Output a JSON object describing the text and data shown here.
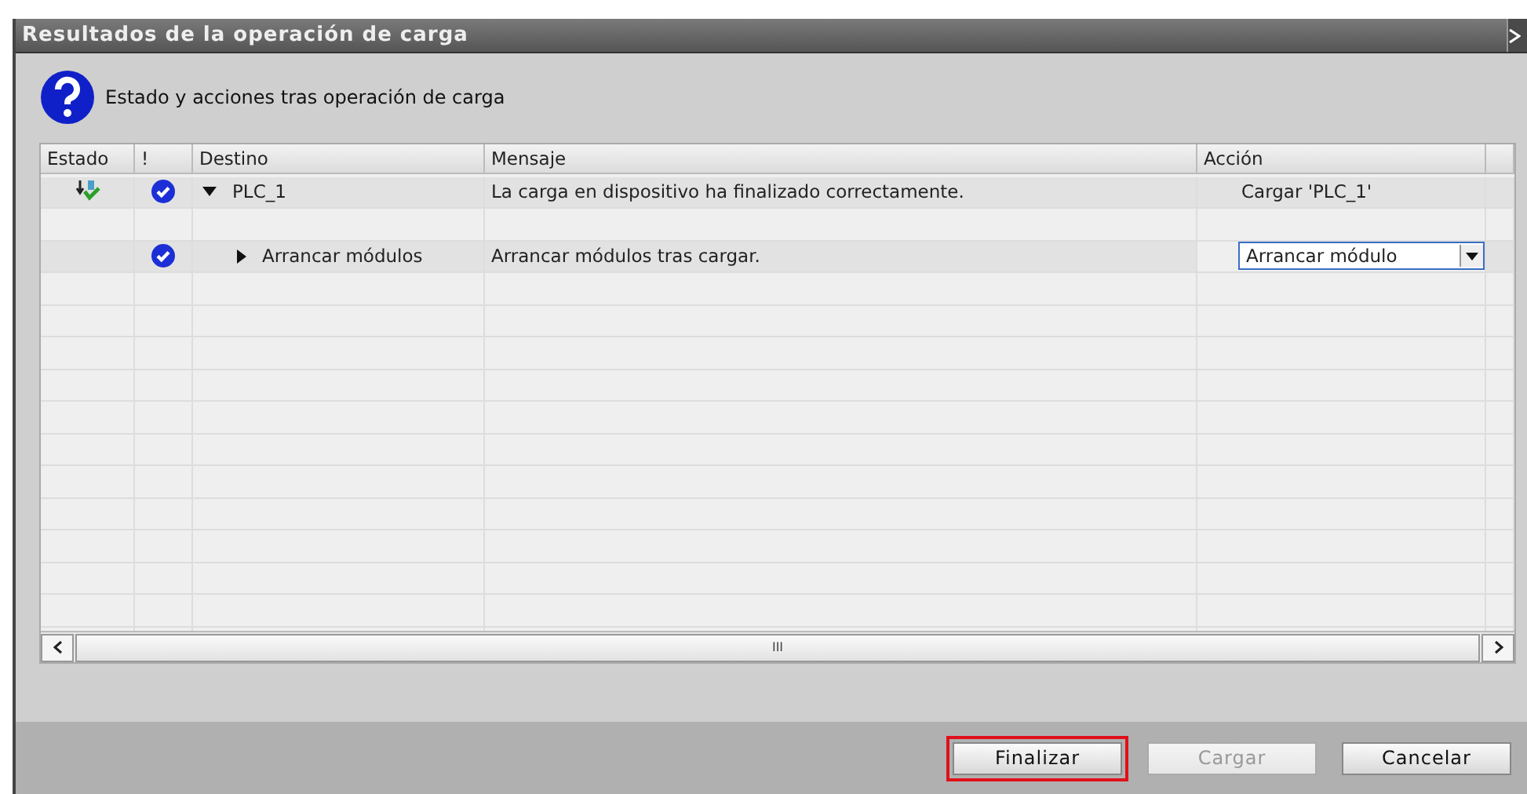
{
  "window": {
    "title": "Resultados de la operación de carga"
  },
  "header": {
    "text": "Estado y acciones tras operación de carga"
  },
  "table": {
    "columns": [
      "Estado",
      "!",
      "Destino",
      "Mensaje",
      "Acción"
    ],
    "rows": [
      {
        "kind": "item",
        "downloaded": true,
        "checked": true,
        "destino": "PLC_1",
        "expanded": true,
        "mensaje": "La carga en dispositivo ha finalizado correctamente.",
        "accion": "Cargar 'PLC_1'",
        "children": [
          {
            "kind": "blank"
          },
          {
            "kind": "dropdown",
            "checked": true,
            "destino": "Arrancar módulos",
            "expanded": false,
            "mensaje": "Arrancar módulos tras cargar.",
            "accion": "Arrancar módulo"
          }
        ]
      }
    ]
  },
  "scrollbar": {
    "thumb_grip": "III"
  },
  "buttons": [
    {
      "label": "Finalizar",
      "disabled": false,
      "highlighted": true
    },
    {
      "label": "Cargar",
      "disabled": true,
      "highlighted": false
    },
    {
      "label": "Cancelar",
      "disabled": false,
      "highlighted": false
    }
  ]
}
